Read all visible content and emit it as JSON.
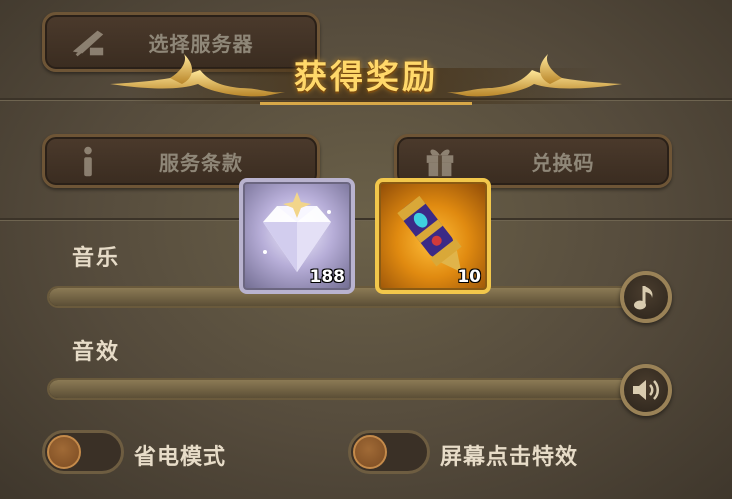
{
  "settings": {
    "server_button_label": "选择服务器",
    "terms_button_label": "服务条款",
    "redeem_button_label": "兑换码",
    "music_label": "音乐",
    "music_level": 1.0,
    "sfx_label": "音效",
    "sfx_level": 1.0,
    "power_saving_label": "省电模式",
    "power_saving_on": false,
    "tap_effect_label": "屏幕点击特效",
    "tap_effect_on": false
  },
  "reward_popup": {
    "title": "获得奖励",
    "items": [
      {
        "icon": "diamond-icon",
        "count": "188"
      },
      {
        "icon": "gauntlet-icon",
        "count": "10"
      }
    ]
  },
  "colors": {
    "title_gold": "#ffd86a",
    "diamond_frame": "#b9b3cf",
    "gauntlet_frame": "#f2c74b"
  }
}
